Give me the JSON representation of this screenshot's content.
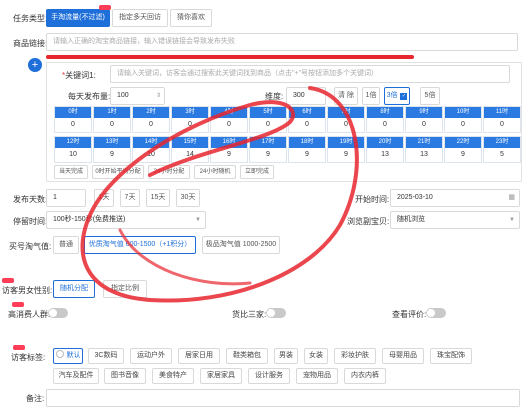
{
  "task_type": {
    "label": "任务类型:",
    "options": [
      "手淘流量(不过滤)",
      "指定多天回访",
      "猜你喜欢"
    ],
    "selected": 0
  },
  "product_link": {
    "label": "商品链接:",
    "placeholder": "请输入正确的淘宝商品链接，输入错误链接会导致发布失败"
  },
  "keyword": {
    "label": "关键词1:",
    "placeholder": "请输入关键词，访客会通过搜索此关键词找到商品（点击\"+\"号按钮添加多个关键词）",
    "add_symbol": "+"
  },
  "daily": {
    "label": "每天发布量:",
    "value": "100",
    "dimension_label": "维度:",
    "dimension_value": "300",
    "clear": "清 除",
    "dim_options": [
      "1倍",
      "3倍",
      "5倍"
    ],
    "dim_selected": 1
  },
  "hours_row1": {
    "labels": [
      "0时",
      "1时",
      "2时",
      "3时",
      "4时",
      "5时",
      "6时",
      "7时",
      "8时",
      "9时",
      "10时",
      "11时"
    ],
    "values": [
      "0",
      "0",
      "0",
      "0",
      "0",
      "0",
      "0",
      "0",
      "0",
      "0",
      "0",
      "0"
    ]
  },
  "hours_row2": {
    "labels": [
      "12时",
      "13时",
      "14时",
      "15时",
      "16时",
      "17时",
      "18时",
      "19时",
      "20时",
      "21时",
      "22时",
      "23时"
    ],
    "values": [
      "10",
      "9",
      "10",
      "14",
      "9",
      "9",
      "9",
      "9",
      "13",
      "13",
      "9",
      "5"
    ]
  },
  "dist_buttons": [
    "当天完成",
    "0时开始平均分配",
    "24小时分配",
    "24小时随机",
    "立即完成"
  ],
  "publish_days": {
    "label": "发布天数:",
    "value": "1",
    "options": [
      "1天",
      "7天",
      "15天",
      "30天"
    ],
    "start_label": "开始时间:",
    "start_value": "2025-03-10"
  },
  "dwell": {
    "label": "停留时间:",
    "value": "100秒-150秒(免费推送)",
    "browse_label": "浏览副宝贝:",
    "browse_value": "随机浏览"
  },
  "taoqi": {
    "label": "买号淘气值:",
    "options": [
      "普通",
      "优质淘气值 600-1500（+1积分）",
      "极品淘气值 1000-2500"
    ],
    "selected": 1
  },
  "gender": {
    "label": "访客男女性别:",
    "options": [
      "随机分配",
      "指定比例"
    ],
    "selected": 0
  },
  "toggles": {
    "high_consume": "高消费人群:",
    "compare": "货比三家:",
    "review": "查看评价:"
  },
  "visitor_tags": {
    "label": "访客标签:",
    "row1": [
      "默认",
      "3C数码",
      "运动户外",
      "居家日用",
      "鞋类箱包",
      "男装",
      "女装",
      "彩妆护肤",
      "母婴用品",
      "珠宝配饰"
    ],
    "row2": [
      "汽车及配件",
      "图书音像",
      "美食特产",
      "家居家具",
      "设计服务",
      "宠物用品",
      "内衣内裤"
    ],
    "selected": 0
  },
  "remark": {
    "label": "备注:"
  },
  "colors": {
    "primary": "#1e6fd9",
    "accent_red": "#e8262e",
    "badge": "#ff3d57"
  }
}
